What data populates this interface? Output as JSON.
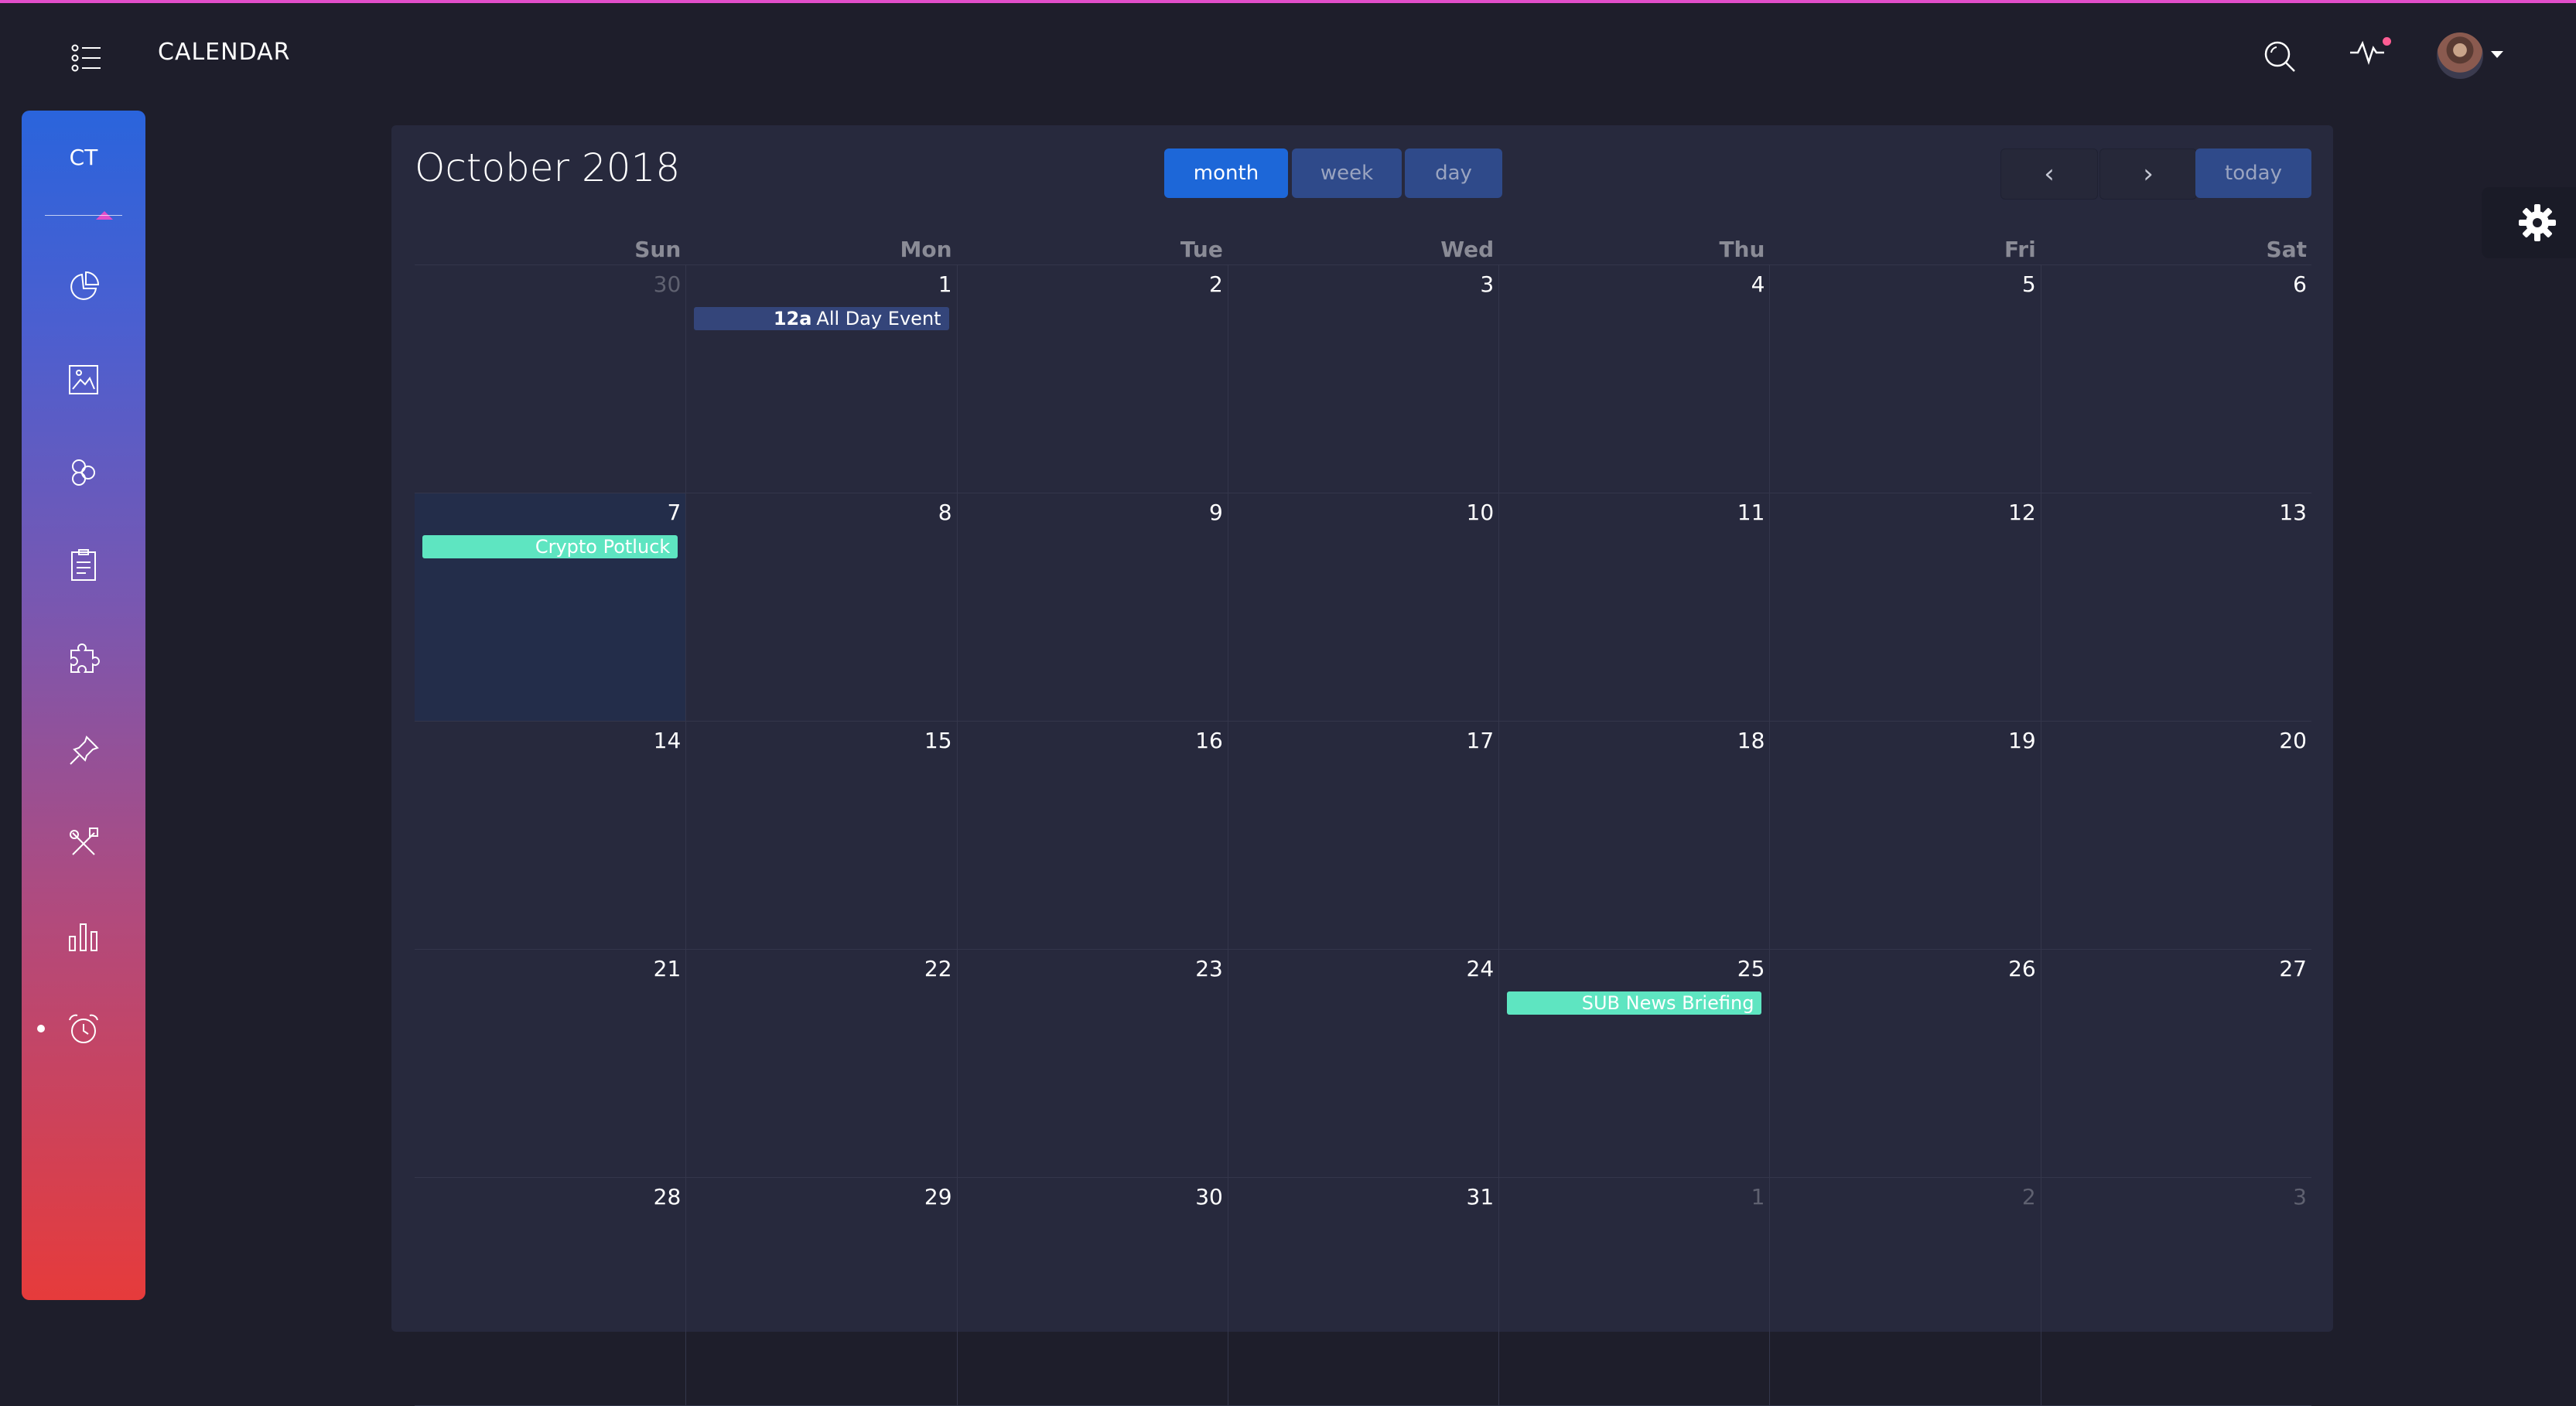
{
  "header": {
    "title": "CALENDAR",
    "menu_icon": "list-icon",
    "search_icon": "search-icon",
    "activity_icon": "activity-icon",
    "avatar_icon": "user-avatar",
    "caret_icon": "caret-down-icon"
  },
  "sidebar": {
    "logo": "CT",
    "items": [
      {
        "icon": "pie-chart-icon"
      },
      {
        "icon": "image-icon"
      },
      {
        "icon": "atom-icon"
      },
      {
        "icon": "clipboard-icon"
      },
      {
        "icon": "puzzle-icon"
      },
      {
        "icon": "pin-icon"
      },
      {
        "icon": "tools-icon"
      },
      {
        "icon": "bar-chart-icon"
      },
      {
        "icon": "alarm-clock-icon",
        "active": true
      }
    ]
  },
  "calendar": {
    "title": "October 2018",
    "views": {
      "month": "month",
      "week": "week",
      "day": "day"
    },
    "active_view": "month",
    "nav": {
      "prev": "‹",
      "next": "›",
      "today": "today"
    },
    "weekdays": [
      "Sun",
      "Mon",
      "Tue",
      "Wed",
      "Thu",
      "Fri",
      "Sat"
    ],
    "weeks": [
      [
        "30",
        "1",
        "2",
        "3",
        "4",
        "5",
        "6"
      ],
      [
        "7",
        "8",
        "9",
        "10",
        "11",
        "12",
        "13"
      ],
      [
        "14",
        "15",
        "16",
        "17",
        "18",
        "19",
        "20"
      ],
      [
        "21",
        "22",
        "23",
        "24",
        "25",
        "26",
        "27"
      ],
      [
        "28",
        "29",
        "30",
        "31",
        "1",
        "2",
        "3"
      ]
    ],
    "events": {
      "all_day_time": "12a",
      "all_day_title": "All Day Event",
      "crypto": "Crypto Potluck",
      "sub": "SUB News Briefing"
    }
  },
  "settings": {
    "icon": "gear-icon"
  },
  "colors": {
    "accent_pink": "#e14eca",
    "primary_blue": "#1d67d8",
    "event_blue": "#34457a",
    "event_green": "#5ee5c1",
    "card_bg": "#27293d",
    "page_bg": "#1e1e2b"
  }
}
